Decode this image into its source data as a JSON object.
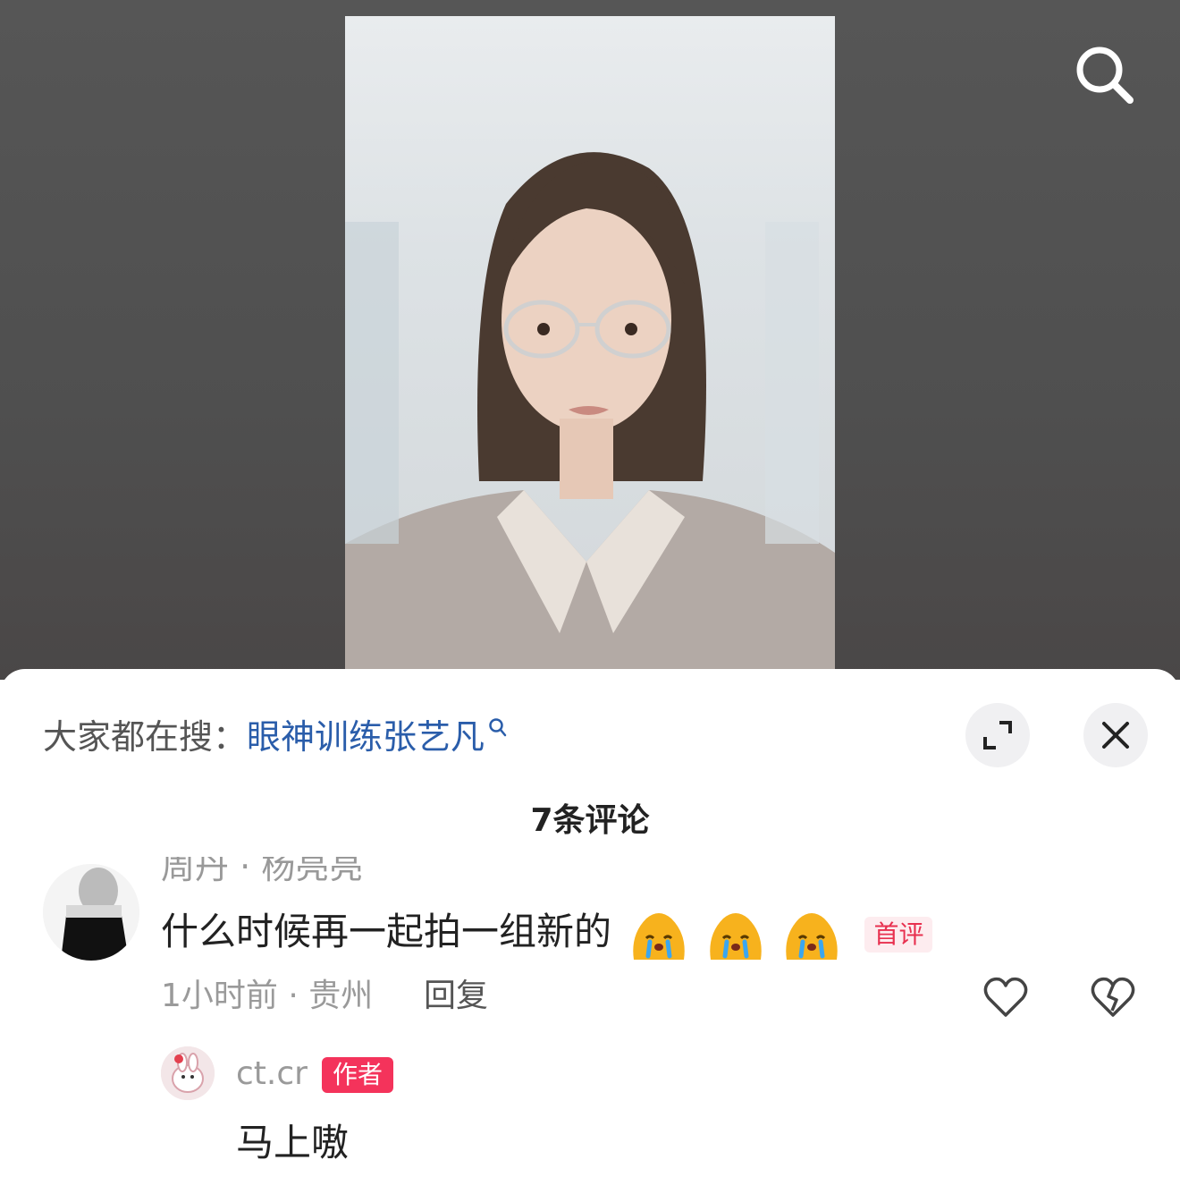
{
  "icons": {
    "search": "search-icon",
    "expand": "expand-icon",
    "close": "close-icon",
    "like": "heart-icon",
    "dislike": "broken-heart-icon",
    "emoji": "crying-emoji-icon"
  },
  "colors": {
    "keyword": "#2a5daa",
    "first_badge": "#e8304f",
    "author_badge_bg": "#f4335b"
  },
  "suggest": {
    "prefix": "大家都在搜：",
    "keyword": "眼神训练张艺凡"
  },
  "comments_header": {
    "count_label": "7条评论"
  },
  "comment": {
    "text": "什么时候再一起拍一组新的",
    "emoji_count": 3,
    "badge": "首评",
    "meta": "1小时前 · 贵州",
    "reply_label": "回复"
  },
  "reply": {
    "author": "ct.cr",
    "author_badge": "作者",
    "text": "马上嗷"
  }
}
